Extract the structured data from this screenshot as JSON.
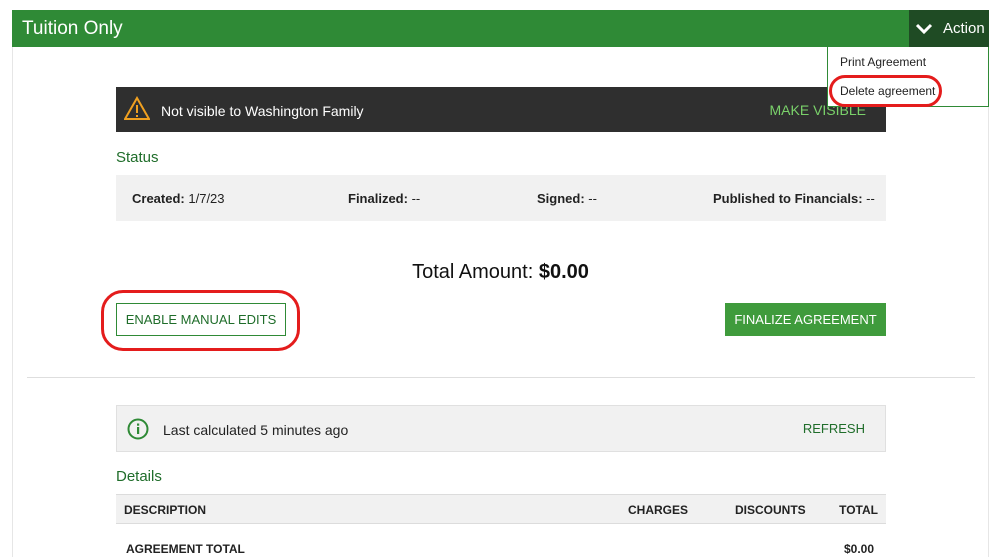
{
  "header": {
    "title": "Tuition Only",
    "action_label": "Action"
  },
  "action_menu": {
    "items": [
      "Print Agreement",
      "Delete agreement"
    ]
  },
  "alert": {
    "text": "Not visible to Washington Family",
    "action": "MAKE VISIBLE"
  },
  "status": {
    "heading": "Status",
    "created_label": "Created:",
    "created_value": "1/7/23",
    "finalized_label": "Finalized:",
    "finalized_value": "--",
    "signed_label": "Signed:",
    "signed_value": "--",
    "published_label": "Published to Financials:",
    "published_value": "--"
  },
  "total": {
    "label": "Total Amount:",
    "value": "$0.00"
  },
  "buttons": {
    "manual_edits": "ENABLE MANUAL EDITS",
    "finalize": "FINALIZE AGREEMENT"
  },
  "calc": {
    "text": "Last calculated 5 minutes ago",
    "refresh": "REFRESH"
  },
  "details": {
    "heading": "Details",
    "columns": [
      "DESCRIPTION",
      "CHARGES",
      "DISCOUNTS",
      "TOTAL"
    ],
    "rows": [
      {
        "description": "AGREEMENT TOTAL",
        "total": "$0.00"
      }
    ]
  },
  "colors": {
    "brand_green": "#2f8a36",
    "dark_green": "#1f4b24",
    "highlight_red": "#e41c1c",
    "alert_bg": "#2f2f2f"
  }
}
